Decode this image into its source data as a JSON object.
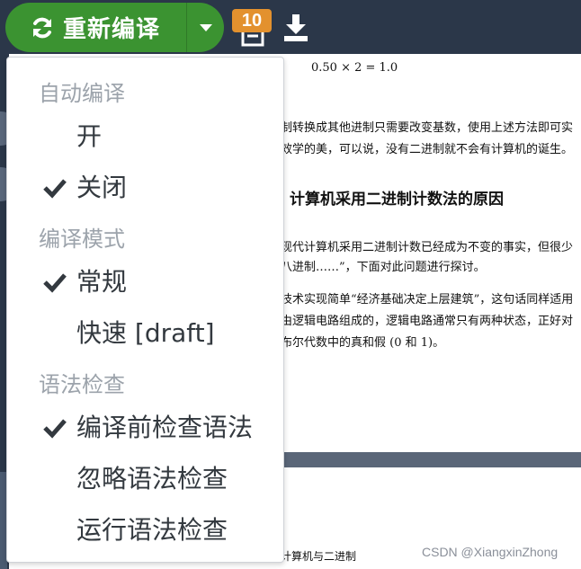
{
  "toolbar": {
    "recompile_label": "重新编译",
    "logs_count": "10",
    "colors": {
      "toolbar_bg": "#2b3749",
      "recompile_green": "#3b9331",
      "badge_orange": "#e3912e"
    }
  },
  "dropdown": {
    "sections": [
      {
        "header": "自动编译",
        "items": [
          {
            "label": "开",
            "checked": false
          },
          {
            "label": "关闭",
            "checked": true
          }
        ]
      },
      {
        "header": "编译模式",
        "items": [
          {
            "label": "常规",
            "checked": true
          },
          {
            "label": "快速 [draft]",
            "checked": false
          }
        ]
      },
      {
        "header": "语法检查",
        "items": [
          {
            "label": "编译前检查语法",
            "checked": true
          },
          {
            "label": "忽略语法检查",
            "checked": false
          },
          {
            "label": "运行语法检查",
            "checked": false
          }
        ]
      }
    ]
  },
  "pdf": {
    "equation": "0.50 × 2 = 1.0",
    "para1_line1": "制转换成其他进制只需要改变基数，使用上述方法即可实",
    "para1_line2": "效学的美，可以说，没有二进制就不会有计算机的诞生。",
    "section_title": "计算机采用二进制计数法的原因",
    "para2_line1": "现代计算机采用二进制计数已经成为不变的事实，但很少",
    "para2_line2": "八进制……”，下面对此问题进行探讨。",
    "para3_line1": "技术实现简单“经济基础决定上层建筑”，这句话同样适用",
    "para3_line2": "由逻辑电路组成的，逻辑电路通常只有两种状态，正好对",
    "para3_line3": "布尔代数中的真和假 (0 和 1)。",
    "page_footer": "计算机与二进制"
  },
  "watermark": "CSDN @XiangxinZhong"
}
